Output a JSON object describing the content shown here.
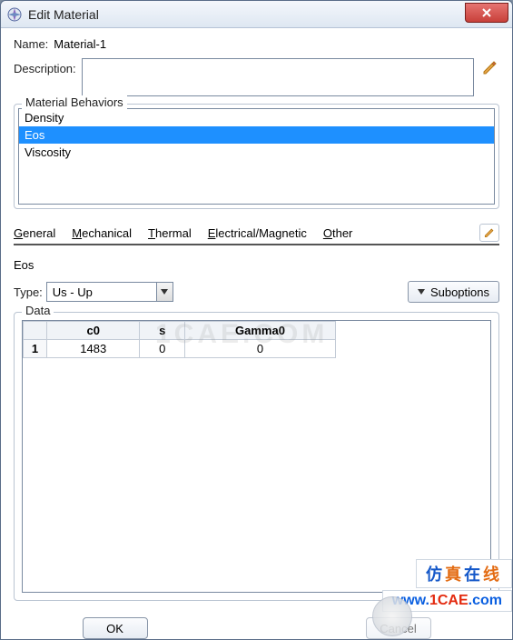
{
  "window": {
    "title": "Edit Material"
  },
  "name": {
    "label": "Name:",
    "value": "Material-1"
  },
  "description": {
    "label": "Description:",
    "value": ""
  },
  "behaviors": {
    "group_label": "Material Behaviors",
    "items": [
      "Density",
      "Eos",
      "Viscosity"
    ],
    "selected_index": 1
  },
  "menubar": {
    "items": [
      {
        "label": "General",
        "u": "G"
      },
      {
        "label": "Mechanical",
        "u": "M"
      },
      {
        "label": "Thermal",
        "u": "T"
      },
      {
        "label": "Electrical/Magnetic",
        "u": "E"
      },
      {
        "label": "Other",
        "u": "O"
      }
    ]
  },
  "section": {
    "title": "Eos"
  },
  "type": {
    "label": "Type:",
    "value": "Us - Up"
  },
  "suboptions": {
    "label": "Suboptions"
  },
  "data_group": {
    "label": "Data"
  },
  "table": {
    "headers": [
      "c0",
      "s",
      "Gamma0"
    ],
    "rows": [
      {
        "n": "1",
        "c0": "1483",
        "s": "0",
        "gamma0": "0"
      }
    ]
  },
  "buttons": {
    "ok": "OK",
    "cancel": "Cancel"
  },
  "watermark": {
    "text": "1CAE.COM"
  },
  "overlay": {
    "banner_cn": "仿真在线",
    "url_prefix": "www.",
    "url_domain": "1CAE",
    "url_tld": ".com"
  }
}
